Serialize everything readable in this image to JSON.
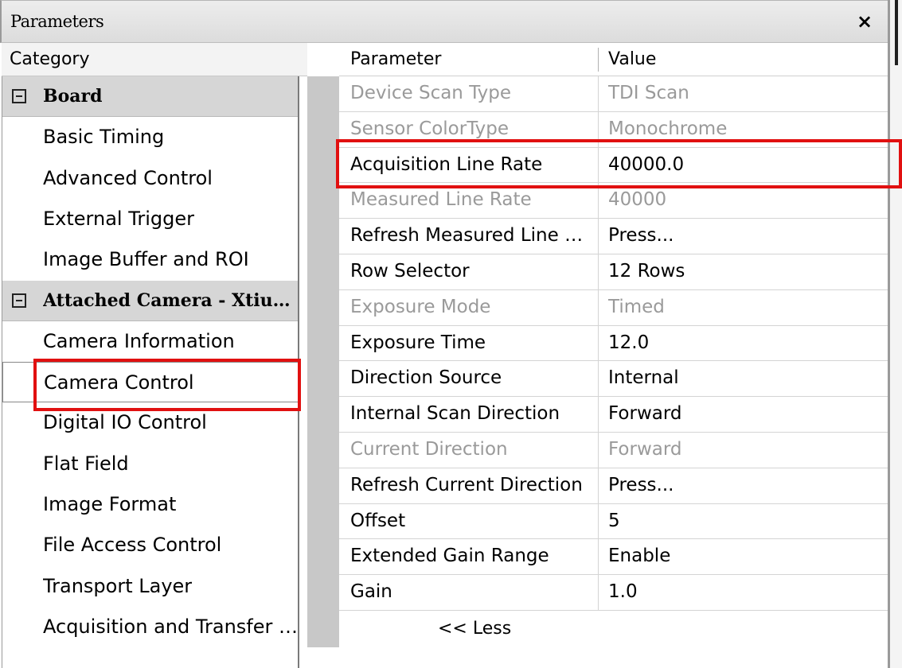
{
  "window": {
    "title": "Parameters",
    "close_symbol": "×"
  },
  "category_panel": {
    "header": "Category",
    "items": [
      {
        "label": "Board",
        "type": "group",
        "expander": "−"
      },
      {
        "label": "Basic Timing",
        "type": "item"
      },
      {
        "label": "Advanced Control",
        "type": "item"
      },
      {
        "label": "External Trigger",
        "type": "item"
      },
      {
        "label": "Image Buffer and ROI",
        "type": "item"
      },
      {
        "label": "Attached Camera - Xtiu…",
        "type": "group",
        "expander": "−"
      },
      {
        "label": "Camera Information",
        "type": "item"
      },
      {
        "label": "Camera Control",
        "type": "item",
        "selected": true
      },
      {
        "label": "Digital IO Control",
        "type": "item"
      },
      {
        "label": "Flat Field",
        "type": "item"
      },
      {
        "label": "Image Format",
        "type": "item"
      },
      {
        "label": "File Access Control",
        "type": "item"
      },
      {
        "label": "Transport Layer",
        "type": "item"
      },
      {
        "label": "Acquisition and Transfer …",
        "type": "item"
      }
    ]
  },
  "parameter_grid": {
    "columns": {
      "parameter": "Parameter",
      "value": "Value"
    },
    "rows": [
      {
        "name": "Device Scan Type",
        "value": "TDI Scan",
        "enabled": false
      },
      {
        "name": "Sensor ColorType",
        "value": "Monochrome",
        "enabled": false
      },
      {
        "name": "Acquisition Line Rate",
        "value": "40000.0",
        "enabled": true,
        "highlighted": true
      },
      {
        "name": "Measured Line Rate",
        "value": "40000",
        "enabled": false
      },
      {
        "name": "Refresh Measured Line …",
        "value": "Press...",
        "enabled": true
      },
      {
        "name": "Row Selector",
        "value": "12 Rows",
        "enabled": true
      },
      {
        "name": "Exposure Mode",
        "value": "Timed",
        "enabled": false
      },
      {
        "name": "Exposure Time",
        "value": "12.0",
        "enabled": true
      },
      {
        "name": "Direction Source",
        "value": "Internal",
        "enabled": true
      },
      {
        "name": "Internal Scan Direction",
        "value": "Forward",
        "enabled": true
      },
      {
        "name": "Current Direction",
        "value": "Forward",
        "enabled": false
      },
      {
        "name": "Refresh Current Direction",
        "value": "Press...",
        "enabled": true
      },
      {
        "name": "Offset",
        "value": "5",
        "enabled": true
      },
      {
        "name": "Extended Gain Range",
        "value": "Enable",
        "enabled": true
      },
      {
        "name": "Gain",
        "value": "1.0",
        "enabled": true
      }
    ],
    "less_link": "<< Less"
  },
  "colors": {
    "highlight_box": "#e11010",
    "disabled_text": "#9a9a9a",
    "group_bg": "#d6d6d6"
  }
}
